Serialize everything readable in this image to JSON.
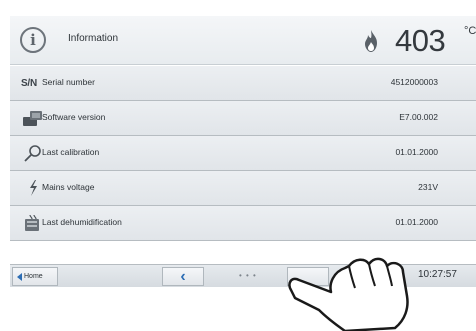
{
  "header": {
    "title": "Information",
    "info_icon": "info-icon",
    "flame_icon": "flame-icon",
    "temperature": "403",
    "temperature_unit": "°C"
  },
  "rows": [
    {
      "icon": "sn-icon",
      "icon_text": "S/N",
      "label": "Serial number",
      "value": "4512000003"
    },
    {
      "icon": "software-icon",
      "label": "Software version",
      "value": "E7.00.002"
    },
    {
      "icon": "calibration-icon",
      "label": "Last calibration",
      "value": "01.01.2000"
    },
    {
      "icon": "lightning-icon",
      "label": "Mains voltage",
      "value": "231V"
    },
    {
      "icon": "dehumidification-icon",
      "label": "Last dehumidification",
      "value": "01.01.2000"
    }
  ],
  "footer": {
    "home_label": "Home",
    "back_icon": "chevron-left-icon",
    "dots": "• • •",
    "time": "10:27:57"
  },
  "colors": {
    "accent": "#2d6db4",
    "flame": "#5a6168"
  }
}
